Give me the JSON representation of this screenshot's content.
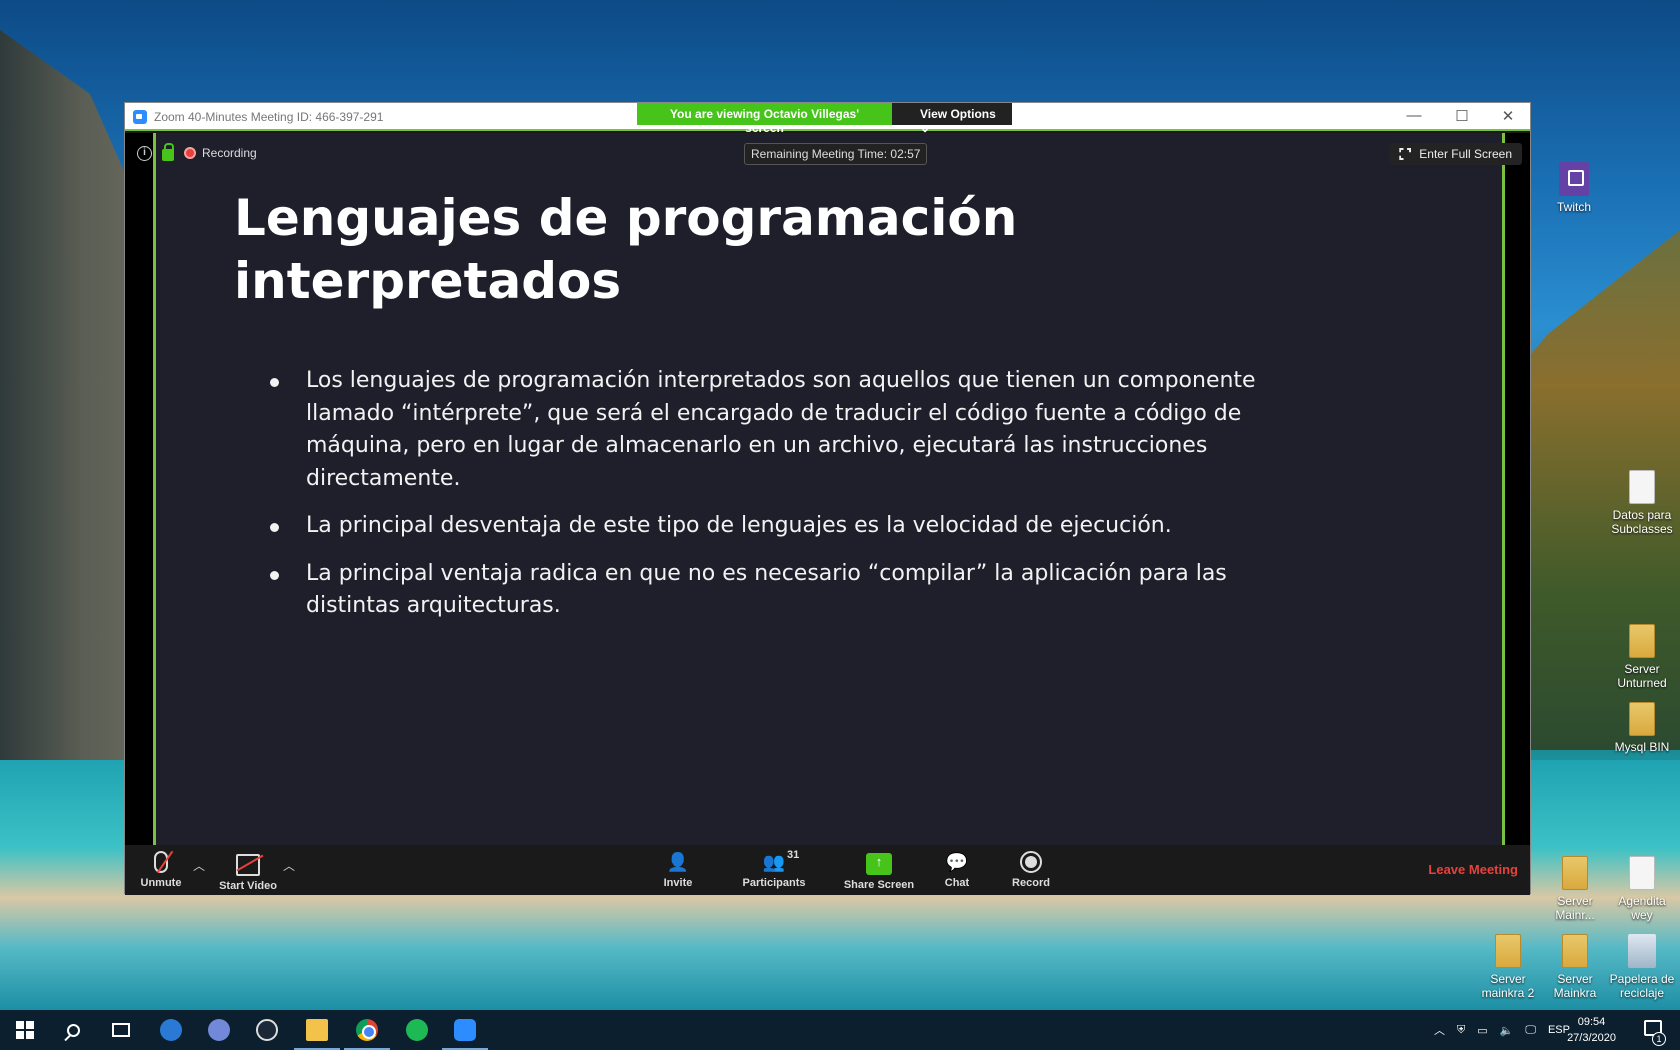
{
  "window": {
    "title": "Zoom 40-Minutes Meeting ID: 466-397-291",
    "viewing_banner": "You are viewing Octavio Villegas' screen",
    "view_options": "View Options",
    "minimize": "—",
    "maximize": "☐",
    "close": "✕"
  },
  "meeting": {
    "recording_label": "Recording",
    "remaining_time": "Remaining Meeting Time: 02:57",
    "fullscreen_label": "Enter Full Screen"
  },
  "slide": {
    "title_line1": "Lenguajes de programación",
    "title_line2": "interpretados",
    "bullets": [
      "Los lenguajes de programación interpretados son aquellos que tienen un componente llamado “intérprete”, que será el encargado de traducir el código fuente a código de máquina, pero en lugar de almacenarlo en un archivo, ejecutará las instrucciones directamente.",
      "La principal desventaja de este tipo de lenguajes es la velocidad de ejecución.",
      "La principal ventaja radica en que no es necesario “compilar” la aplicación para las distintas arquitecturas."
    ]
  },
  "toolbar": {
    "unmute": "Unmute",
    "start_video": "Start Video",
    "invite": "Invite",
    "participants": "Participants",
    "participants_count": "31",
    "share_screen": "Share Screen",
    "chat": "Chat",
    "record": "Record",
    "leave": "Leave Meeting"
  },
  "desktop_icons": {
    "twitch": "Twitch",
    "datos": "Datos para Subclasses",
    "server_unturned": "Server Unturned",
    "mysql": "Mysql BIN",
    "server_mainr": "Server Mainr...",
    "agendita": "Agendita wey",
    "server_mainkra2": "Server mainkra 2",
    "server_mainkra": "Server Mainkra",
    "papelera": "Papelera de reciclaje"
  },
  "taskbar": {
    "language": "ESP",
    "time": "09:54",
    "date": "27/3/2020",
    "notification_count": "1"
  }
}
